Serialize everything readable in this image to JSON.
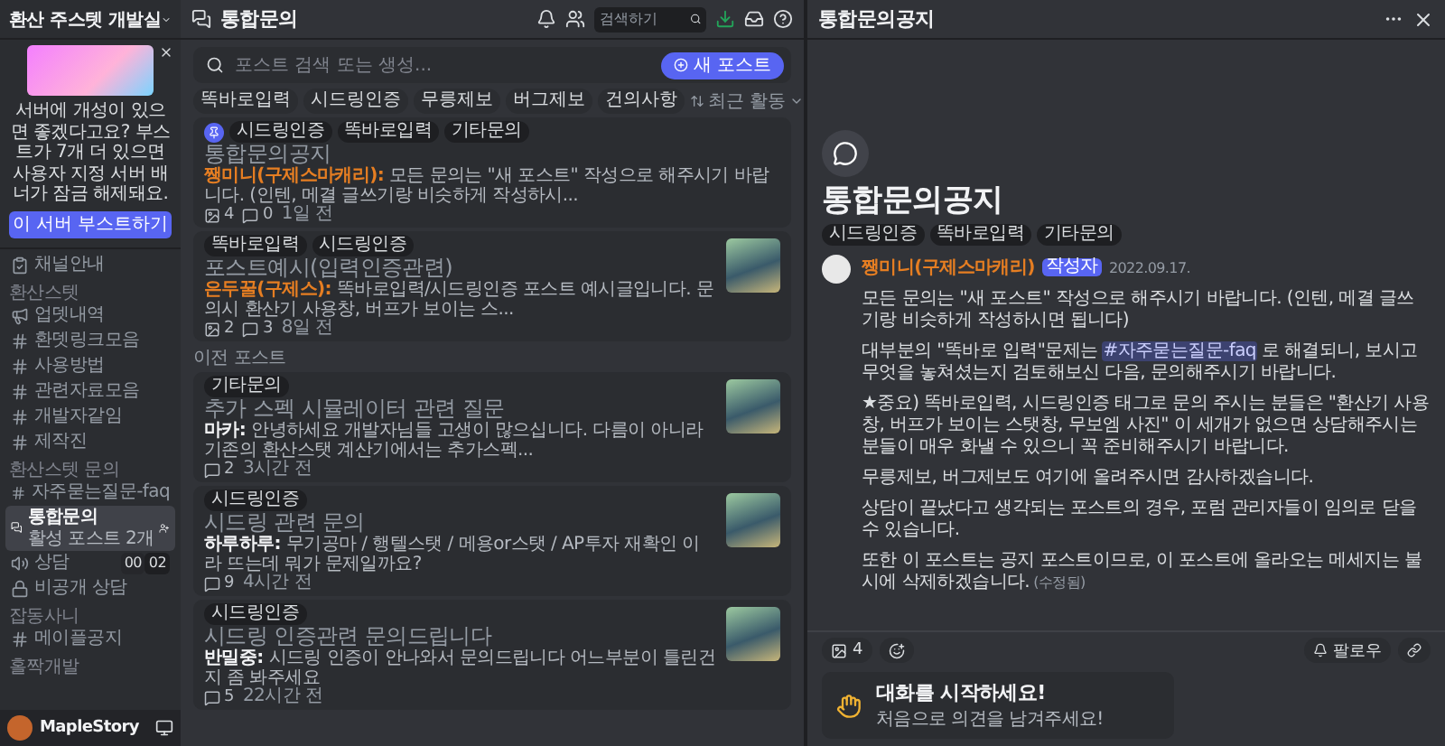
{
  "server": {
    "name": "환산 주스텟 개발실"
  },
  "boost": {
    "text": "서버에 개성이 있으면 좋겠다고요? 부스트가 7개 더 있으면 사용자 지정 서버 배너가 잠금 해제돼요.",
    "button": "이 서버 부스트하기"
  },
  "sidebar": {
    "items": [
      {
        "kind": "info",
        "label": "채널안내",
        "selected": false
      },
      {
        "kind": "category",
        "label": "환산스텟"
      },
      {
        "kind": "announcement",
        "label": "업뎃내역",
        "selected": false
      },
      {
        "kind": "text",
        "label": "환뎃링크모음",
        "selected": false
      },
      {
        "kind": "text",
        "label": "사용방법",
        "selected": false
      },
      {
        "kind": "text",
        "label": "관련자료모음",
        "selected": false
      },
      {
        "kind": "text",
        "label": "개발자같임",
        "selected": false
      },
      {
        "kind": "text",
        "label": "제작진",
        "selected": false
      },
      {
        "kind": "category",
        "label": "환산스텟 문의"
      },
      {
        "kind": "text",
        "label": "자주묻는질문-faq",
        "selected": false
      },
      {
        "kind": "forum",
        "label": "통합문의",
        "sublabel": "활성 포스트 2개",
        "selected": true
      },
      {
        "kind": "voice",
        "label": "상담",
        "counts": [
          "00",
          "02"
        ],
        "selected": false
      },
      {
        "kind": "voice-locked",
        "label": "비공개 상담",
        "selected": false
      },
      {
        "kind": "category",
        "label": "잡동사니"
      },
      {
        "kind": "text",
        "label": "메이플공지",
        "selected": false
      },
      {
        "kind": "category",
        "label": "홀짝개발"
      }
    ]
  },
  "user": {
    "name": "MapleStory"
  },
  "forum": {
    "title": "통합문의",
    "search_placeholder": "검색하기",
    "post_search_placeholder": "포스트 검색 또는 생성...",
    "new_post_button": "새 포스트",
    "filter_tags": [
      "똑바로입력",
      "시드링인증",
      "무릉제보",
      "버그제보",
      "건의사항"
    ],
    "sort": "최근 활동",
    "sections": [
      {
        "posts": [
          {
            "pinned": true,
            "tags": [
              "시드링인증",
              "똑바로입력",
              "기타문의"
            ],
            "title": "통합문의공지",
            "author": {
              "name": "쨍미니(구제스마캐리):",
              "color": "#e67e22"
            },
            "preview": "모든 문의는 \"새 포스트\" 작성으로 해주시기 바랍니다. (인텐, 메결 글쓰기랑 비슷하게 작성하시...",
            "stats": [
              {
                "kind": "image",
                "value": "4"
              },
              {
                "kind": "message",
                "value": "0"
              }
            ],
            "time": "1일 전",
            "thumbnail": false
          },
          {
            "pinned": false,
            "tags": [
              "똑바로입력",
              "시드링인증"
            ],
            "title": "포스트예시(입력인증관련)",
            "author": {
              "name": "은두꿀(구제스):",
              "color": "#e67e22"
            },
            "preview": "똑바로입력/시드링인증 포스트 예시글입니다. 문의시 환산기 사용창, 버프가 보이는 스...",
            "stats": [
              {
                "kind": "image",
                "value": "2"
              },
              {
                "kind": "message",
                "value": "3"
              }
            ],
            "time": "8일 전",
            "thumbnail": true
          }
        ]
      },
      {
        "label": "이전 포스트",
        "posts": [
          {
            "pinned": false,
            "tags": [
              "기타문의"
            ],
            "title": "추가 스펙 시뮬레이터 관련 질문",
            "author": {
              "name": "마카:",
              "color": "#f2f3f5"
            },
            "preview": "안녕하세요 개발자님들 고생이 많으십니다. 다름이 아니라 기존의 환산스탯 계산기에서는 추가스펙...",
            "stats": [
              {
                "kind": "message",
                "value": "2"
              }
            ],
            "time": "3시간 전",
            "thumbnail": true
          },
          {
            "pinned": false,
            "tags": [
              "시드링인증"
            ],
            "title": "시드링 관련 문의",
            "author": {
              "name": "하루하루:",
              "color": "#f2f3f5"
            },
            "preview": "무기공마 / 행텔스탯 / 메용or스탯 / AP투자 재확인 이라 뜨는데 뭐가 문제일까요?",
            "stats": [
              {
                "kind": "message",
                "value": "9"
              }
            ],
            "time": "4시간 전",
            "thumbnail": true
          },
          {
            "pinned": false,
            "tags": [
              "시드링인증"
            ],
            "title": "시드링 인증관련 문의드립니다",
            "author": {
              "name": "반밀중:",
              "color": "#f2f3f5"
            },
            "preview": "시드링 인증이 안나와서 문의드립니다 어느부분이 틀린건지 좀 봐주세요",
            "stats": [
              {
                "kind": "message",
                "value": "5"
              }
            ],
            "time": "22시간 전",
            "thumbnail": true
          }
        ]
      }
    ]
  },
  "thread": {
    "header_title": "통합문의공지",
    "title": "통합문의공지",
    "tags": [
      "시드링인증",
      "똑바로입력",
      "기타문의"
    ],
    "message": {
      "author": {
        "name": "쨍미니(구제스마캐리)",
        "color": "#e67e22"
      },
      "badge": "작성자",
      "date": "2022.09.17.",
      "paragraphs": [
        {
          "parts": [
            {
              "kind": "text",
              "text": "모든 문의는 \"새 포스트\" 작성으로 해주시기 바랍니다. (인텐, 메결 글쓰기랑 비슷하게 작성하시면 됩니다)"
            }
          ]
        },
        {
          "parts": [
            {
              "kind": "text",
              "text": "대부분의 \"똑바로 입력\"문제는"
            },
            {
              "kind": "mention",
              "text": "#자주묻는질문-faq"
            },
            {
              "kind": "text",
              "text": "로 해결되니, 보시고 무엇을 놓쳐셨는지 검토해보신 다음, 문의해주시기 바랍니다."
            }
          ]
        },
        {
          "parts": [
            {
              "kind": "text",
              "text": "★중요) 똑바로입력, 시드링인증 태그로 문의 주시는 분들은 \"환산기 사용창, 버프가 보이는 스탯창, 무보엠 사진\" 이 세개가 없으면 상담해주시는 분들이 매우 화낼 수 있으니 꼭 준비해주시기 바랍니다."
            }
          ]
        },
        {
          "parts": [
            {
              "kind": "text",
              "text": "무릉제보, 버그제보도 여기에 올려주시면 감사하겠습니다."
            }
          ]
        },
        {
          "parts": [
            {
              "kind": "text",
              "text": "상담이 끝났다고 생각되는 포스트의 경우, 포럼 관리자들이 임의로 닫을 수 있습니다."
            }
          ]
        },
        {
          "parts": [
            {
              "kind": "text",
              "text": "또한 이 포스트는 공지 포스트이므로, 이 포스트에 올라오는 메세지는 불시에 삭제하겠습니다."
            },
            {
              "kind": "edited",
              "text": "(수정됨)"
            }
          ]
        }
      ]
    },
    "reactions": [
      {
        "kind": "image",
        "value": "4"
      }
    ],
    "follow_button": "팔로우",
    "start": {
      "title": "대화를 시작하세요!",
      "subtitle": "처음으로 의견을 남겨주세요!"
    }
  }
}
